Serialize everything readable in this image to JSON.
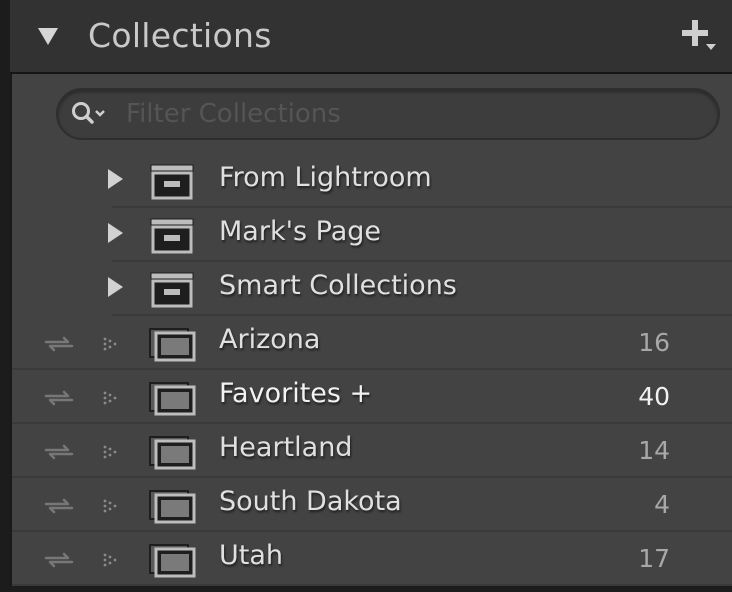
{
  "panel": {
    "title": "Collections",
    "add_icon": "plus-with-dropdown-icon",
    "collapse_icon": "triangle-down-icon"
  },
  "search": {
    "placeholder": "Filter Collections",
    "icon": "magnifier-dropdown-icon"
  },
  "sets": [
    {
      "label": "From Lightroom",
      "icon": "collection-set-icon"
    },
    {
      "label": "Mark's Page",
      "icon": "collection-set-icon"
    },
    {
      "label": "Smart Collections",
      "icon": "collection-set-icon"
    }
  ],
  "collections": [
    {
      "label": "Arizona",
      "count": "16",
      "target": false
    },
    {
      "label": "Favorites  +",
      "count": "40",
      "target": true
    },
    {
      "label": "Heartland",
      "count": "14",
      "target": false
    },
    {
      "label": "South Dakota",
      "count": "4",
      "target": false
    },
    {
      "label": "Utah",
      "count": "17",
      "target": false
    }
  ],
  "colors": {
    "panel_bg": "#434343",
    "header_bg": "#323232",
    "text": "#e0e0e0",
    "count": "#a8a8a8",
    "target_text": "#f2f2f2"
  }
}
